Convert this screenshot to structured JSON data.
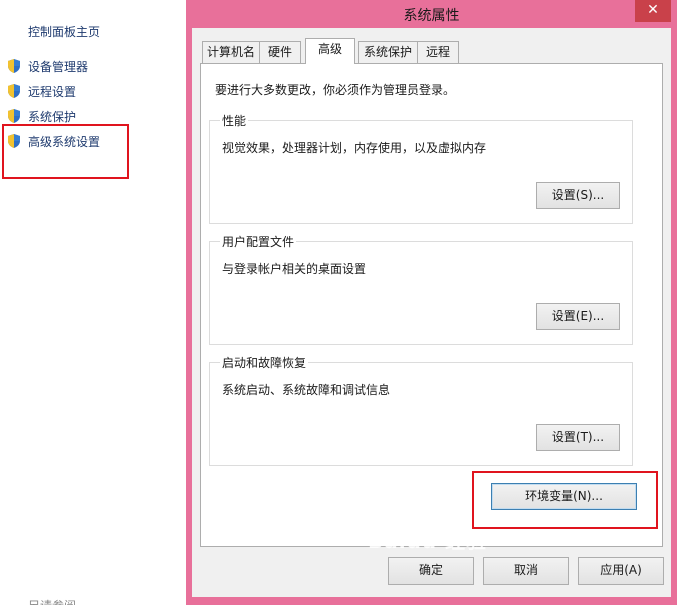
{
  "control_panel": {
    "home_label": "控制面板主页",
    "links": [
      {
        "label": "设备管理器",
        "icon": "uac-shield-icon"
      },
      {
        "label": "远程设置",
        "icon": "uac-shield-icon"
      },
      {
        "label": "系统保护",
        "icon": "uac-shield-icon"
      },
      {
        "label": "高级系统设置",
        "icon": "uac-shield-icon"
      }
    ],
    "cut_off_label": "另请参阅"
  },
  "dialog": {
    "title": "系统属性",
    "close_glyph": "✕",
    "tabs": [
      {
        "label": "计算机名",
        "active": false
      },
      {
        "label": "硬件",
        "active": false
      },
      {
        "label": "高级",
        "active": true
      },
      {
        "label": "系统保护",
        "active": false
      },
      {
        "label": "远程",
        "active": false
      }
    ],
    "intro": "要进行大多数更改，你必须作为管理员登录。",
    "groups": {
      "performance": {
        "title": "性能",
        "desc": "视觉效果，处理器计划，内存使用，以及虚拟内存",
        "button": "设置(S)..."
      },
      "profiles": {
        "title": "用户配置文件",
        "desc": "与登录帐户相关的桌面设置",
        "button": "设置(E)..."
      },
      "startup": {
        "title": "启动和故障恢复",
        "desc": "系统启动、系统故障和调试信息",
        "button": "设置(T)..."
      }
    },
    "env_button": "环境变量(N)...",
    "ok_button": "确定",
    "cancel_button": "取消",
    "apply_button": "应用(A)"
  },
  "colors": {
    "frame": "#e8709a",
    "highlight_box": "#e0141e",
    "close_button": "#c9414a"
  },
  "watermark": "Baidu 经验"
}
